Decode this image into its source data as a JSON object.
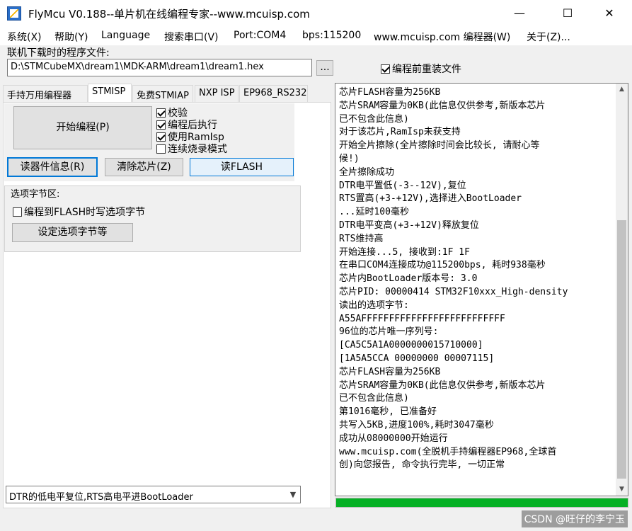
{
  "window": {
    "title": "FlyMcu V0.188--单片机在线编程专家--www.mcuisp.com",
    "minimize": "—",
    "maximize": "☐",
    "close": "✕"
  },
  "menu": [
    "系统(X)",
    "帮助(Y)",
    "Language",
    "搜索串口(V)",
    "Port:COM4",
    "bps:115200",
    "www.mcuisp.com 编程器(W)",
    "关于(Z)..."
  ],
  "file": {
    "label": "联机下载时的程序文件:",
    "path": "D:\\STMCubeMX\\dream1\\MDK-ARM\\dream1\\dream1.hex",
    "browse": "...",
    "reload_label": "编程前重装文件",
    "reload_checked": true
  },
  "tabs": [
    "手持万用编程器",
    "STMISP",
    "免费STMIAP",
    "NXP ISP",
    "EP968_RS232"
  ],
  "stmisp": {
    "start_button": "开始编程(P)",
    "options": [
      {
        "label": "校验",
        "checked": true
      },
      {
        "label": "编程后执行",
        "checked": true
      },
      {
        "label": "使用RamIsp",
        "checked": true
      },
      {
        "label": "连续烧录模式",
        "checked": false
      }
    ],
    "read_info": "读器件信息(R)",
    "erase_chip": "清除芯片(Z)",
    "read_flash": "读FLASH",
    "option_group_title": "选项字节区:",
    "write_option_label": "编程到FLASH时写选项字节",
    "set_option_button": "设定选项字节等"
  },
  "reset_mode": "DTR的低电平复位,RTS高电平进BootLoader",
  "log": [
    "芯片FLASH容量为256KB",
    "芯片SRAM容量为0KB(此信息仅供参考,新版本芯片",
    "已不包含此信息)",
    "对于该芯片,RamIsp未获支持",
    "开始全片擦除(全片擦除时间会比较长, 请耐心等",
    "候!)",
    "全片擦除成功",
    "DTR电平置低(-3--12V),复位",
    "RTS置高(+3-+12V),选择进入BootLoader",
    "...延时100毫秒",
    "DTR电平变高(+3-+12V)释放复位",
    "RTS维持高",
    "开始连接...5, 接收到:1F 1F",
    "在串口COM4连接成功@115200bps, 耗时938毫秒",
    "芯片内BootLoader版本号: 3.0",
    "芯片PID: 00000414  STM32F10xxx_High-density",
    "读出的选项字节:",
    "A55AFFFFFFFFFFFFFFFFFFFFFFFFFF",
    "96位的芯片唯一序列号:",
    "[CA5C5A1A0000000015710000]",
    "[1A5A5CCA 00000000 00007115]",
    "芯片FLASH容量为256KB",
    "芯片SRAM容量为0KB(此信息仅供参考,新版本芯片",
    "已不包含此信息)",
    "第1016毫秒, 已准备好",
    "共写入5KB,进度100%,耗时3047毫秒",
    "成功从08000000开始运行",
    "www.mcuisp.com(全脱机手持编程器EP968,全球首",
    "创)向您报告, 命令执行完毕, 一切正常"
  ],
  "progress": 1.0,
  "watermark": "CSDN @旺仔的李宁玉",
  "colors": {
    "progress": "#06b025",
    "accent": "#0078d7"
  }
}
